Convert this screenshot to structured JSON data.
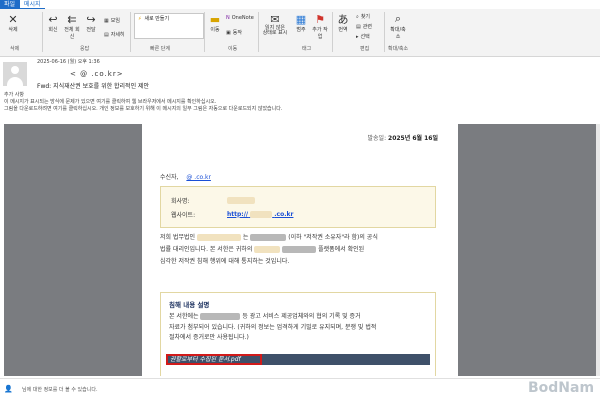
{
  "tabs": {
    "file": "파일",
    "message": "메시지"
  },
  "ribbon": {
    "delete": "삭제",
    "reply": "회신",
    "reply_all": "전체 회신",
    "forward": "전달",
    "meeting": "모임",
    "more": "자세히",
    "quick_step": "새로 만들기",
    "move": "이동",
    "onenote": "OneNote",
    "actions": "동작",
    "mark_unread": "읽지 않은 상태로 표시",
    "categorize": "범주",
    "followup": "추가 작업",
    "translate": "번역",
    "find": "찾기",
    "related": "관련",
    "select": "선택",
    "zoom": "확대/축소",
    "groups": {
      "delete": "삭제",
      "respond": "응답",
      "quick": "빠른 단계",
      "move": "이동",
      "tags": "태그",
      "edit": "편집",
      "zoom": "확대/축소"
    }
  },
  "header": {
    "date": "2025-06-16 (월) 오후 1:36",
    "sender": "<        @        .co.kr>",
    "subject": "Fwd: 지식재산권 보호를 위한 합리적인 제안",
    "notice_title": "추가 사항",
    "notice_lines": [
      "이 메시지가 표시되는 방식에 문제가 있으면 여기를 클릭하여 웹 브라우저에서 메시지를 확인하십시오.",
      "그림을 다운로드하려면 여기를 클릭하십시오. 개인 정보를 보호하기 위해 이 메시지의 일부 그림은 자동으로 다운로드되지 않았습니다."
    ]
  },
  "document": {
    "send_date_label": "발송일:",
    "send_date_value": "2025년 6월 16일",
    "recipient_label": "수신자,",
    "recipient_link": "@        .co.kr",
    "company_label": "회사명:",
    "website_label": "웹사이트:",
    "website_prefix": "http://",
    "website_suffix": ".co.kr",
    "body_line1_a": "저희 법무법인",
    "body_line1_b": "는",
    "body_line1_c": "(이하 \"저작권 소유자\"라 함)의 공식",
    "body_line2": "법률 대리인입니다. 본 서한은 귀하의",
    "body_line2_b": "플랫폼에서 확인된",
    "body_line3": "심각한 저작권 침해 행위에 대해 통지하는 것입니다.",
    "detail_title": "침해 내용 설명",
    "detail_line1_a": "본 서한에는",
    "detail_line1_b": "등 광고 서비스 제공업체와의 협의 기록 및 증거",
    "detail_line2": "자료가 첨부되어 있습니다. (귀하의 정보는 엄격하게 기밀로 유지되며, 분쟁 및 법적",
    "detail_line3": "절차에서 증거로만 사용됩니다.)",
    "attachment_label": "권할로부터 수집된 문서.pdf"
  },
  "statusbar": {
    "text": "님에 대한 정보를 더 볼 수 있습니다."
  },
  "watermark": "BodNam",
  "colors": {
    "accent": "#1e6cc8",
    "attachment_bar": "#3e5069",
    "highlight_border": "#d11a1a",
    "side_gray": "#7a7c80"
  }
}
